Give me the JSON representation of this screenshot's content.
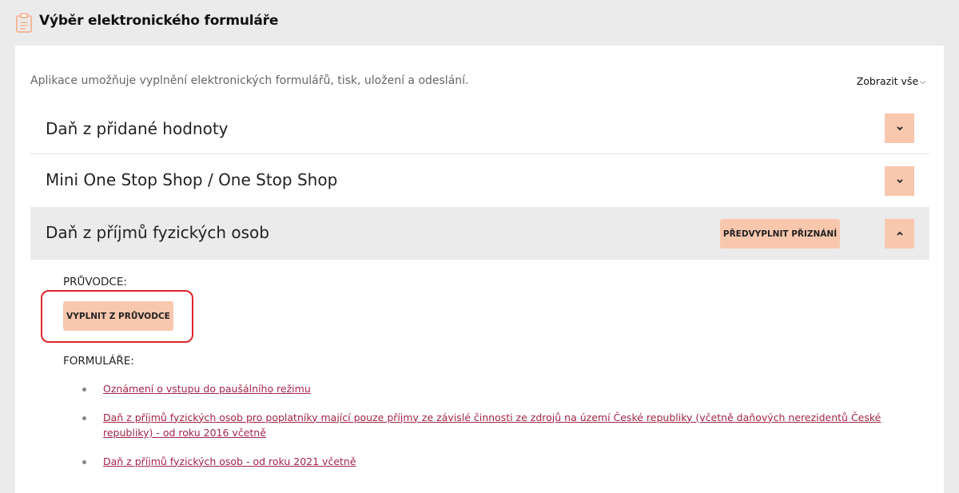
{
  "header": {
    "title": "Výběr elektronického formuláře",
    "icon": "clipboard-icon"
  },
  "intro": {
    "text": "Aplikace umožňuje vyplnění elektronických formulářů, tisk, uložení a odeslání.",
    "show_all_label": "Zobrazit vše"
  },
  "sections": [
    {
      "title": "Daň z přidané hodnoty",
      "expanded": false
    },
    {
      "title": "Mini One Stop Shop / One Stop Shop",
      "expanded": false
    },
    {
      "title": "Daň z příjmů fyzických osob",
      "expanded": true,
      "prefill_label": "PŘEDVYPLNIT PŘIZNÁNÍ"
    }
  ],
  "expanded_section": {
    "guides_label": "PRŮVODCE:",
    "wizard_button_label": "VYPLNIT Z PRŮVODCE",
    "forms_label": "FORMULÁŘE:",
    "forms": [
      "Oznámení o vstupu do paušálního režimu",
      "Daň z příjmů fyzických osob pro poplatníky mající pouze příjmy ze závislé činnosti ze zdrojů na území České republiky (včetně daňových nerezidentů České republiky) - od roku 2016 včetně",
      "Daň z příjmů fyzických osob - od roku 2021 včetně"
    ]
  },
  "colors": {
    "accent": "#f8c7ae",
    "link": "#a3254a",
    "highlight": "#e0262b"
  }
}
